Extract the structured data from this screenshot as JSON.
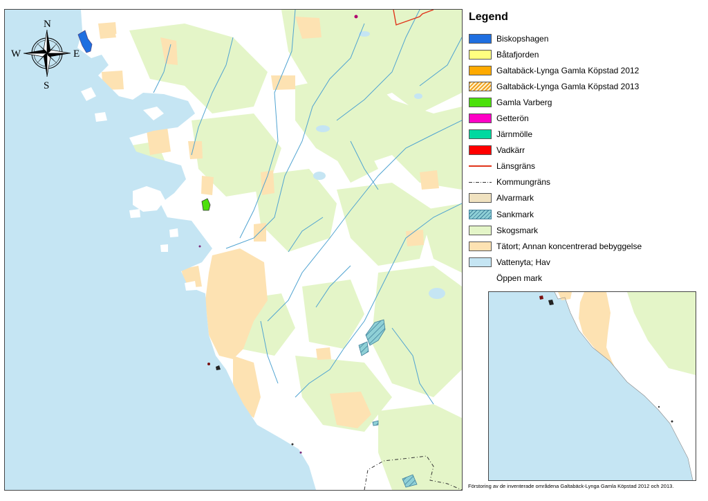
{
  "legend": {
    "title": "Legend",
    "items": [
      {
        "label": "Biskopshagen",
        "kind": "fill",
        "color": "#1f6fe0",
        "icon": "blue-fill-swatch"
      },
      {
        "label": "Båtafjorden",
        "kind": "fill",
        "color": "#ffff80",
        "icon": "yellow-fill-swatch"
      },
      {
        "label": "Galtabäck-Lynga Gamla Köpstad 2012",
        "kind": "fill",
        "color": "#ffaa00",
        "icon": "orange-fill-swatch"
      },
      {
        "label": "Galtabäck-Lynga Gamla Köpstad 2013",
        "kind": "hatch",
        "color": "#f0a020",
        "icon": "orange-hatch-swatch"
      },
      {
        "label": "Gamla Varberg",
        "kind": "fill",
        "color": "#4ce00c",
        "icon": "green-fill-swatch"
      },
      {
        "label": "Getterön",
        "kind": "fill",
        "color": "#ff00c5",
        "icon": "magenta-fill-swatch"
      },
      {
        "label": "Järnmölle",
        "kind": "fill",
        "color": "#00d9a0",
        "icon": "teal-fill-swatch"
      },
      {
        "label": "Vadkärr",
        "kind": "fill",
        "color": "#ff0000",
        "icon": "red-fill-swatch"
      },
      {
        "label": "Länsgräns",
        "kind": "line",
        "color": "#e0341a",
        "icon": "county-border-line"
      },
      {
        "label": "Kommungräns",
        "kind": "dash",
        "color": "#333333",
        "icon": "municipal-border-line"
      },
      {
        "label": "Alvarmark",
        "kind": "fill",
        "color": "#f0e2c0",
        "icon": "alvar-fill-swatch"
      },
      {
        "label": "Sankmark",
        "kind": "wet",
        "color": "#8fd0d6",
        "icon": "wetland-hatch-swatch"
      },
      {
        "label": "Skogsmark",
        "kind": "fill",
        "color": "#e4f5c8",
        "icon": "forest-fill-swatch"
      },
      {
        "label": "Tätort; Annan koncentrerad bebyggelse",
        "kind": "fill",
        "color": "#fde2b2",
        "icon": "urban-fill-swatch"
      },
      {
        "label": "Vattenyta; Hav",
        "kind": "fill",
        "color": "#c5e5f3",
        "icon": "water-fill-swatch"
      },
      {
        "label": "Öppen mark",
        "kind": "none",
        "color": "#ffffff",
        "icon": "open-land-swatch"
      }
    ]
  },
  "compass": {
    "north": "N",
    "south": "S",
    "east": "E",
    "west": "W"
  },
  "caption": "Förstoring av de inventerade områdena Galtabäck-Lynga Gamla Köpstad 2012 och 2013.",
  "colors": {
    "sea": "#c5e5f3",
    "forest": "#e4f5c8",
    "urban": "#fde2b2",
    "open": "#ffffff",
    "river": "#4fa3d1",
    "county_border": "#e0341a",
    "municipal_border": "#333333"
  }
}
